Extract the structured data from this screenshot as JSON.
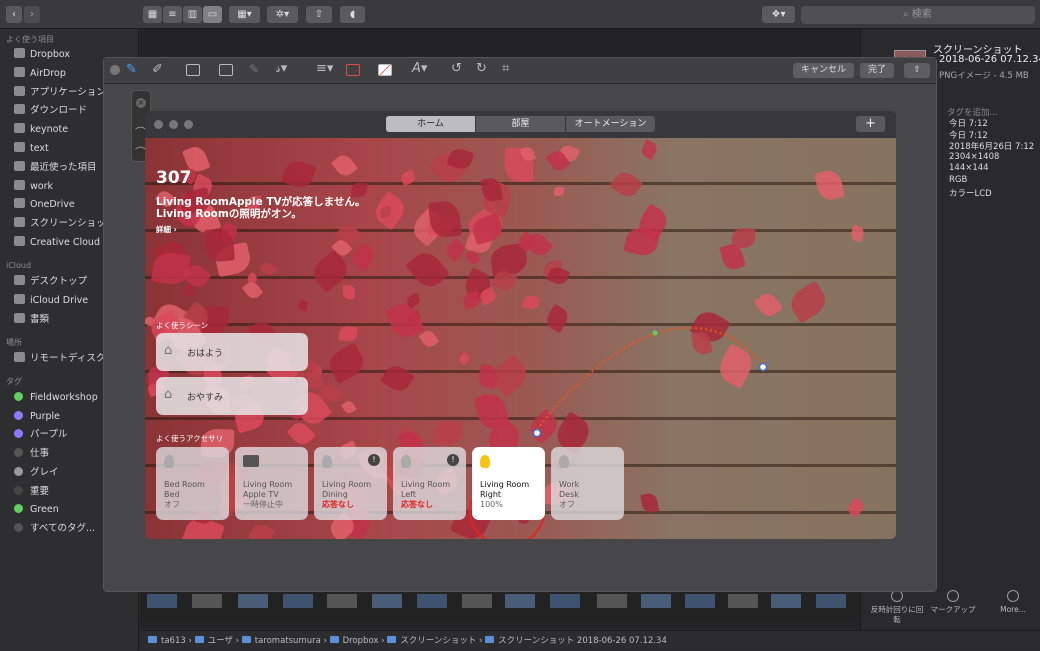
{
  "finder": {
    "search_placeholder": "検索",
    "sidebar": {
      "favorites_header": "よく使う項目",
      "favorites": [
        "Dropbox",
        "AirDrop",
        "アプリケーション",
        "ダウンロード",
        "keynote",
        "text",
        "最近使った項目",
        "work",
        "OneDrive",
        "スクリーンショット",
        "Creative Cloud Files"
      ],
      "icloud_header": "iCloud",
      "icloud": [
        "デスクトップ",
        "iCloud Drive",
        "書類"
      ],
      "places_header": "場所",
      "places": [
        "リモートディスク"
      ],
      "tags_header": "タグ",
      "tags": [
        {
          "label": "Fieldworkshop",
          "color": "#5fcf5f"
        },
        {
          "label": "Purple",
          "color": "#8a7cff"
        },
        {
          "label": "パープル",
          "color": "#8a7cff"
        },
        {
          "label": "仕事",
          "color": "#555555"
        },
        {
          "label": "グレイ",
          "color": "#9a9a9a"
        },
        {
          "label": "重要",
          "color": "#444444"
        },
        {
          "label": "Green",
          "color": "#5fcf5f"
        },
        {
          "label": "すべてのタグ...",
          "color": "#555555"
        }
      ]
    },
    "inspector": {
      "filename": "スクリーンショット",
      "filename2": "2018-06-26 07.12.34",
      "kind": "PNGイメージ - 4.5 MB",
      "tags_placeholder": "タグを追加...",
      "rows": [
        "今日 7:12",
        "今日 7:12",
        "2018年6月26日 7:12",
        "2304×1408",
        "144×144",
        "RGB",
        "カラーLCD"
      ],
      "actions": [
        "反時計回りに回転",
        "マークアップ",
        "More..."
      ]
    },
    "pathbar": [
      "ta613",
      "ユーザ",
      "taromatsumura",
      "Dropbox",
      "スクリーンショット",
      "スクリーンショット 2018-06-26 07.12.34"
    ]
  },
  "markup": {
    "cancel": "キャンセル",
    "done": "完了"
  },
  "home": {
    "tabs": [
      "ホーム",
      "部屋",
      "オートメーション"
    ],
    "add": "+",
    "headline": "307",
    "status1": "Living RoomApple TVが応答しません。",
    "status2": "Living Roomの照明がオン。",
    "details": "詳細 ›",
    "scenes_header": "よく使うシーン",
    "scenes": [
      "おはよう",
      "おやすみ"
    ],
    "accessories_header": "よく使うアクセサリ",
    "accessories": [
      {
        "room": "Bed Room",
        "name": "Bed",
        "status": "オフ",
        "alert": false,
        "on": false
      },
      {
        "room": "Living Room",
        "name": "Apple TV",
        "status": "一時停止中",
        "alert": false,
        "on": false
      },
      {
        "room": "Living Room",
        "name": "Dining",
        "status": "応答なし",
        "alert": true,
        "on": false
      },
      {
        "room": "Living Room",
        "name": "Left",
        "status": "応答なし",
        "alert": true,
        "on": false
      },
      {
        "room": "Living Room",
        "name": "Right",
        "status": "100%",
        "alert": false,
        "on": true
      },
      {
        "room": "Work",
        "name": "Desk",
        "status": "オフ",
        "alert": false,
        "on": false
      }
    ]
  }
}
